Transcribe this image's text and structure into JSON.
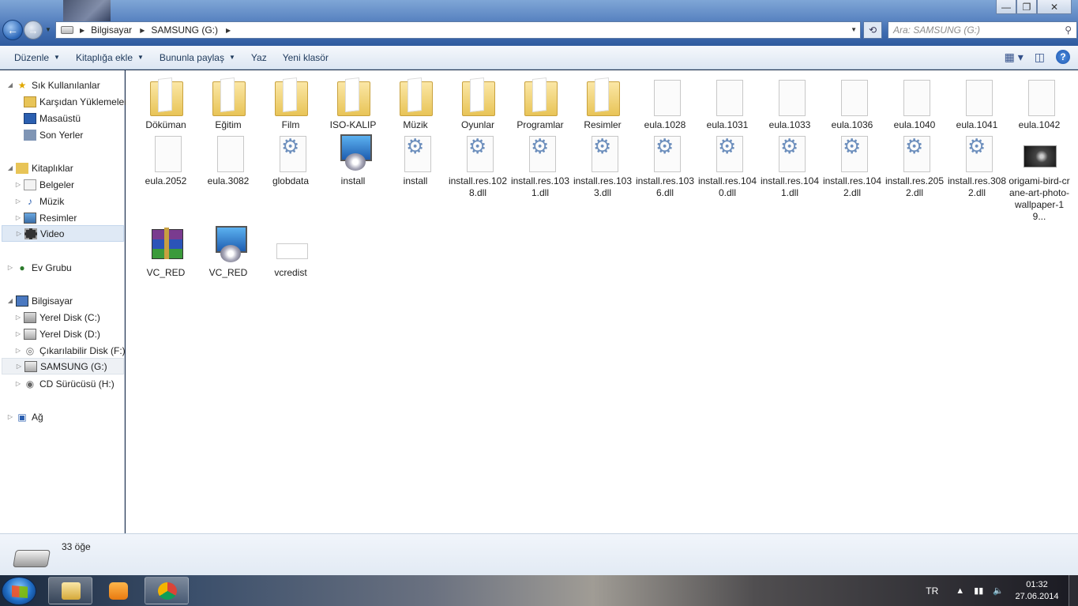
{
  "window": {
    "buttons": {
      "minimize": "—",
      "maximize": "❐",
      "close": "✕"
    }
  },
  "address": {
    "crumbs": [
      "Bilgisayar",
      "SAMSUNG (G:)"
    ],
    "search_placeholder": "Ara: SAMSUNG (G:)"
  },
  "toolbar": {
    "organize": "Düzenle",
    "add_to_library": "Kitaplığa ekle",
    "share_with": "Bununla paylaş",
    "burn": "Yaz",
    "new_folder": "Yeni klasör"
  },
  "sidebar": {
    "favorites": {
      "label": "Sık Kullanılanlar",
      "items": [
        "Karşıdan Yüklemeler",
        "Masaüstü",
        "Son Yerler"
      ]
    },
    "libraries": {
      "label": "Kitaplıklar",
      "items": [
        "Belgeler",
        "Müzik",
        "Resimler",
        "Video"
      ]
    },
    "homegroup": "Ev Grubu",
    "computer": {
      "label": "Bilgisayar",
      "items": [
        "Yerel Disk (C:)",
        "Yerel Disk (D:)",
        "Çıkarılabilir Disk (F:)",
        "SAMSUNG (G:)",
        "CD Sürücüsü (H:)"
      ]
    },
    "network": "Ağ",
    "selected": "Video"
  },
  "files": [
    {
      "name": "Döküman",
      "type": "folder"
    },
    {
      "name": "Eğitim",
      "type": "folder"
    },
    {
      "name": "Film",
      "type": "folder"
    },
    {
      "name": "ISO-KALIP",
      "type": "folder"
    },
    {
      "name": "Müzik",
      "type": "folder"
    },
    {
      "name": "Oyunlar",
      "type": "folder"
    },
    {
      "name": "Programlar",
      "type": "folder"
    },
    {
      "name": "Resimler",
      "type": "folder"
    },
    {
      "name": "eula.1028",
      "type": "doc"
    },
    {
      "name": "eula.1031",
      "type": "doc"
    },
    {
      "name": "eula.1033",
      "type": "doc"
    },
    {
      "name": "eula.1036",
      "type": "doc"
    },
    {
      "name": "eula.1040",
      "type": "doc"
    },
    {
      "name": "eula.1041",
      "type": "doc"
    },
    {
      "name": "eula.1042",
      "type": "doc"
    },
    {
      "name": "eula.2052",
      "type": "doc"
    },
    {
      "name": "eula.3082",
      "type": "doc"
    },
    {
      "name": "globdata",
      "type": "gear"
    },
    {
      "name": "install",
      "type": "setup"
    },
    {
      "name": "install",
      "type": "gear"
    },
    {
      "name": "install.res.1028.dll",
      "type": "gear"
    },
    {
      "name": "install.res.1031.dll",
      "type": "gear"
    },
    {
      "name": "install.res.1033.dll",
      "type": "gear"
    },
    {
      "name": "install.res.1036.dll",
      "type": "gear"
    },
    {
      "name": "install.res.1040.dll",
      "type": "gear"
    },
    {
      "name": "install.res.1041.dll",
      "type": "gear"
    },
    {
      "name": "install.res.1042.dll",
      "type": "gear"
    },
    {
      "name": "install.res.2052.dll",
      "type": "gear"
    },
    {
      "name": "install.res.3082.dll",
      "type": "gear"
    },
    {
      "name": "origami-bird-crane-art-photo-wallpaper-19...",
      "type": "photo"
    },
    {
      "name": "VC_RED",
      "type": "rar"
    },
    {
      "name": "VC_RED",
      "type": "setup"
    },
    {
      "name": "vcredist",
      "type": "blank"
    }
  ],
  "status": {
    "count": "33 öğe"
  },
  "taskbar": {
    "lang": "TR",
    "time": "01:32",
    "date": "27.06.2014"
  },
  "colors": {
    "selection": "#dfe9f5",
    "link": "#1e395b"
  }
}
